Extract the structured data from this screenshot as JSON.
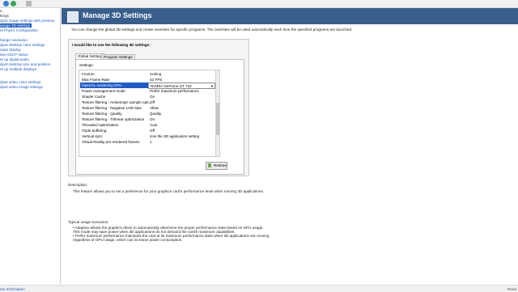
{
  "nav": {
    "items": [
      {
        "label": "s..",
        "type": "cat"
      },
      {
        "label": "ttings",
        "type": "cat"
      },
      {
        "label": "djust image settings with preview",
        "type": "link"
      },
      {
        "label": "anage 3D settings",
        "type": "selected"
      },
      {
        "label": "et PhysX Configuration",
        "type": "link"
      },
      {
        "label": "",
        "type": "cat"
      },
      {
        "label": "hange resolution",
        "type": "link"
      },
      {
        "label": "djust desktop color settings",
        "type": "link"
      },
      {
        "label": "otate display",
        "type": "link"
      },
      {
        "label": "iew HDCP status",
        "type": "link"
      },
      {
        "label": "et up digital audio",
        "type": "link"
      },
      {
        "label": "djust desktop size and position",
        "type": "link"
      },
      {
        "label": "et up multiple displays",
        "type": "link"
      },
      {
        "label": "",
        "type": "cat"
      },
      {
        "label": "djust video color settings",
        "type": "link"
      },
      {
        "label": "djust video image settings",
        "type": "link"
      }
    ]
  },
  "status": {
    "link": "em Information",
    "right": "Read"
  },
  "header": {
    "title": "Manage 3D Settings"
  },
  "intro": "You can change the global 3D settings and create overrides for specific programs. The overrides will be used automatically each time the specified programs are launched.",
  "panel": {
    "heading": "I would like to use the following 3D settings:",
    "tabs": [
      {
        "label": "Global Settings",
        "active": true
      },
      {
        "label": "Program Settings",
        "active": false
      }
    ],
    "settings_label": "Settings:",
    "columns": {
      "feature": "Feature",
      "setting": "Setting"
    },
    "rows": [
      {
        "feature": "Max Frame Rate",
        "setting": "42 FPS"
      },
      {
        "feature": "OpenGL rendering GPU",
        "setting": "NVIDIA GeForce GT 710",
        "selected": true
      },
      {
        "feature": "Power management mode",
        "setting": "Prefer maximum performance"
      },
      {
        "feature": "Shader Cache",
        "setting": "On"
      },
      {
        "feature": "Texture filtering - Anisotropic sample opti...",
        "setting": "Off"
      },
      {
        "feature": "Texture filtering - Negative LOD bias",
        "setting": "Allow"
      },
      {
        "feature": "Texture filtering - Quality",
        "setting": "Quality"
      },
      {
        "feature": "Texture filtering - Trilinear optimization",
        "setting": "On"
      },
      {
        "feature": "Threaded optimization",
        "setting": "Auto"
      },
      {
        "feature": "Triple buffering",
        "setting": "Off"
      },
      {
        "feature": "Vertical sync",
        "setting": "Use the 3D application setting"
      },
      {
        "feature": "Virtual Reality pre-rendered frames",
        "setting": "1"
      }
    ],
    "restore_label": "Restore"
  },
  "description": {
    "label": "Description:",
    "text": "This feature allows you to set a preference for your graphics card's performance level when running 3D applications."
  },
  "usage": {
    "label": "Typical usage scenarios:",
    "lines": [
      "• Adaptive allows the graphics driver to automatically determine the proper performance state based on GPU usage.",
      "  This mode may save power when 3D applications do not demand the card's maximum capabilities.",
      "• Prefer maximum performance maintains the card at its maximum performance state when 3D applications are running",
      "  regardless of GPU usage, which can increase power consumption."
    ]
  },
  "colors": {
    "accent": "#1c5ccb",
    "header_bg": "#385f8c"
  }
}
